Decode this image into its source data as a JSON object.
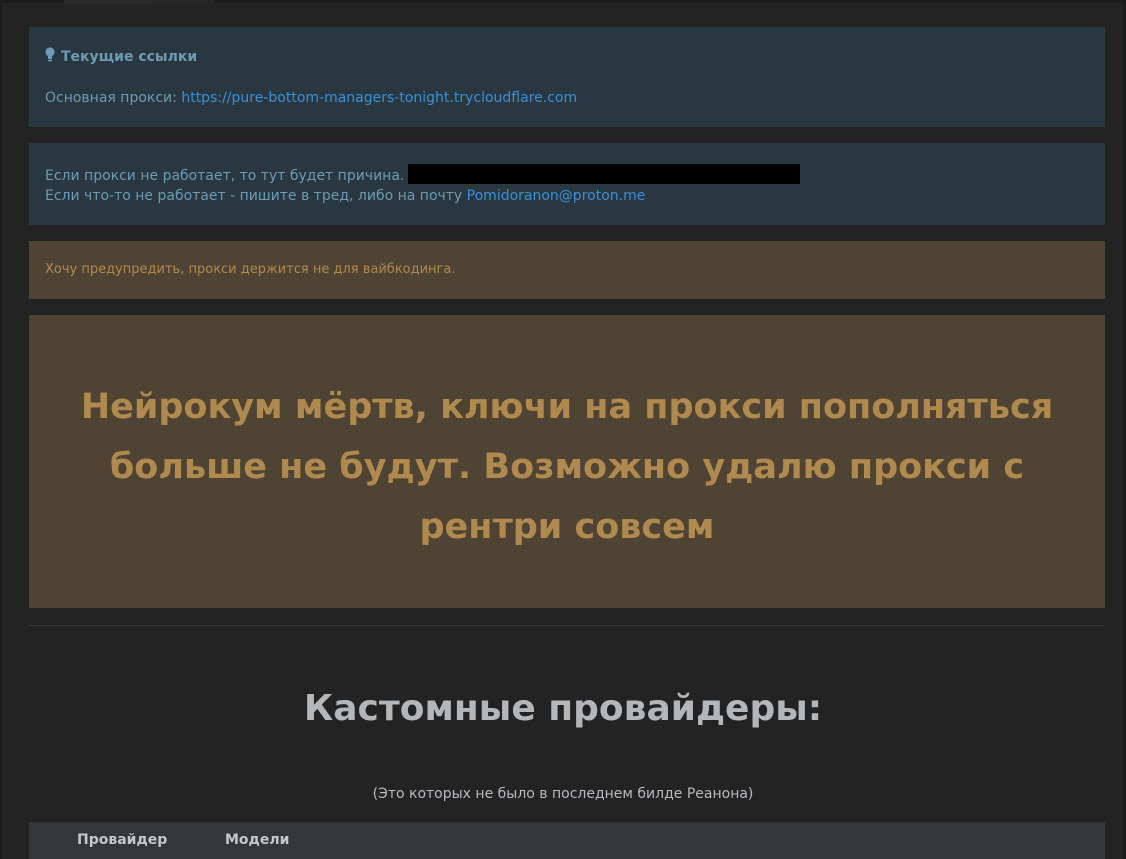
{
  "links_panel": {
    "title": "Текущие ссылки",
    "main_proxy_label": "Основная прокси:",
    "main_proxy_url": "https://pure-bottom-managers-tonight.trycloudflare.com"
  },
  "status_panel": {
    "reason_text": "Если прокси не работает, то тут будет причина.",
    "contact_text": "Если что-то не работает - пишите в тред, либо на почту",
    "contact_email": "Pomidoranon@proton.me"
  },
  "warning_panel": {
    "text": "Хочу предупредить, прокси держится не для вайбкодинга."
  },
  "announcement": {
    "text": "Нейрокум мёртв, ключи на прокси пополняться больше не будут. Возможно удалю прокси с рентри совсем"
  },
  "providers_section": {
    "heading": "Кастомные провайдеры:",
    "note": "(Это которых не было в последнем билде Реанона)",
    "columns": [
      "Провайдер",
      "Модели"
    ]
  },
  "icons": {
    "lightbulb": "lightbulb-icon"
  }
}
